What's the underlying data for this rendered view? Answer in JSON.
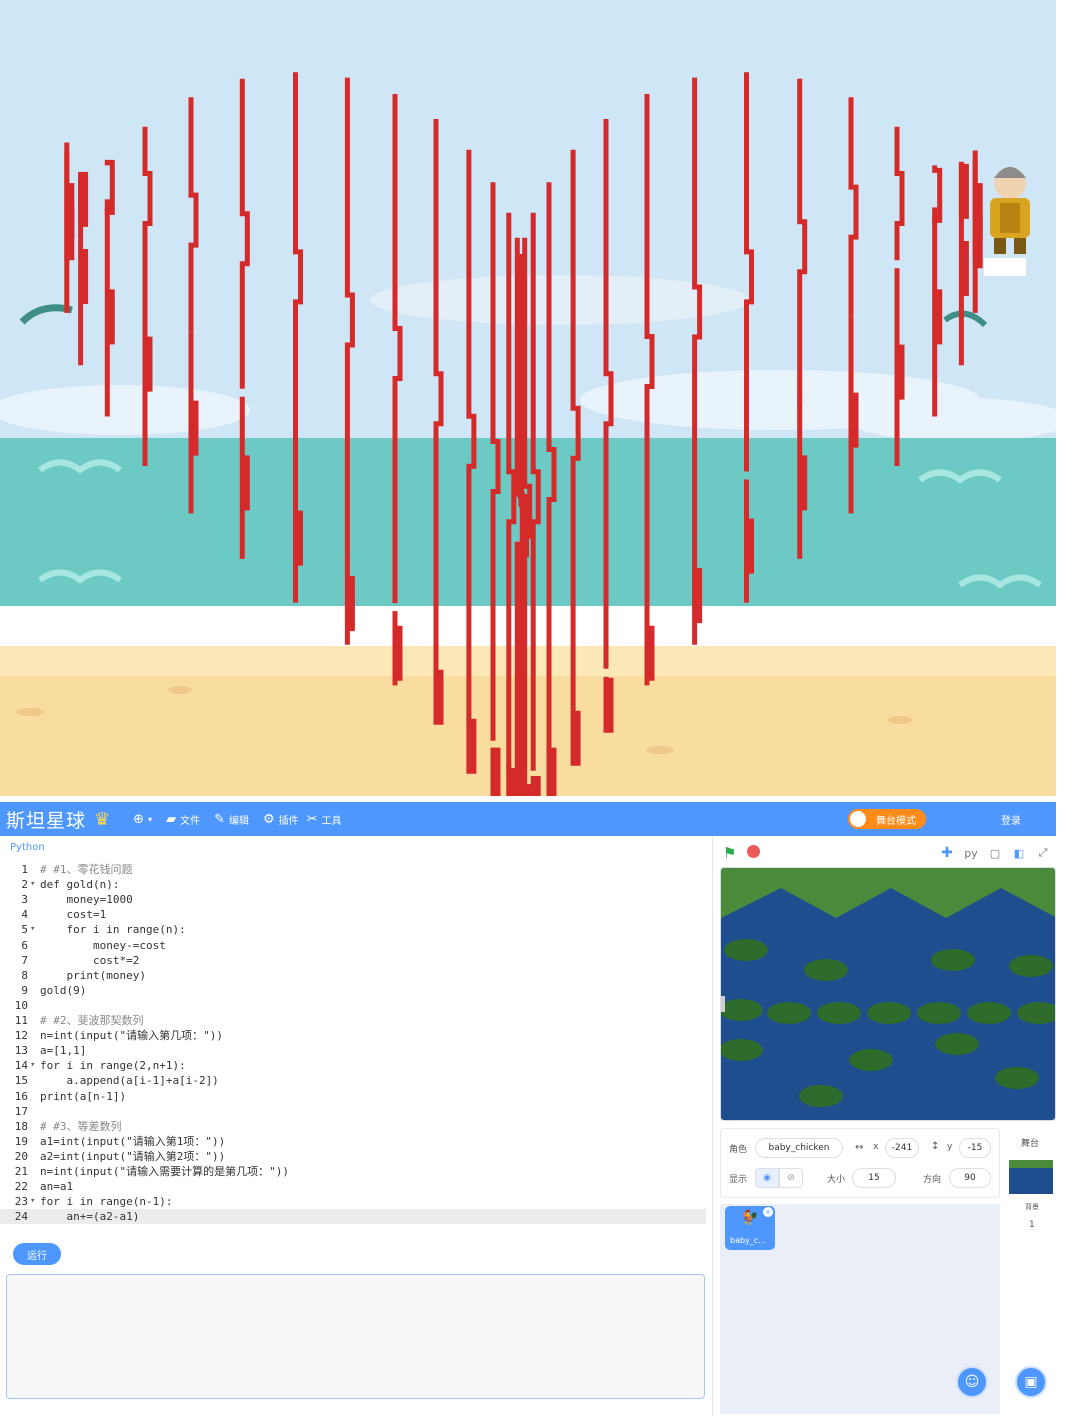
{
  "menubar": {
    "logo": "斯坦星球",
    "file": "文件",
    "edit": "编辑",
    "widgets": "插件",
    "tools": "工具",
    "stage_mode": "舞台模式",
    "login": "登录"
  },
  "editor": {
    "language": "Python",
    "lines": [
      {
        "n": "1",
        "fold": "",
        "code": "# #1、零花钱问题",
        "type": "cmt"
      },
      {
        "n": "2",
        "fold": "▾",
        "code": "def gold(n):",
        "type": "code"
      },
      {
        "n": "3",
        "fold": "",
        "code": "    money=1000",
        "type": "code"
      },
      {
        "n": "4",
        "fold": "",
        "code": "    cost=1",
        "type": "code"
      },
      {
        "n": "5",
        "fold": "▾",
        "code": "    for i in range(n):",
        "type": "code"
      },
      {
        "n": "6",
        "fold": "",
        "code": "        money-=cost",
        "type": "code"
      },
      {
        "n": "7",
        "fold": "",
        "code": "        cost*=2",
        "type": "code"
      },
      {
        "n": "8",
        "fold": "",
        "code": "    print(money)",
        "type": "code"
      },
      {
        "n": "9",
        "fold": "",
        "code": "gold(9)",
        "type": "code"
      },
      {
        "n": "10",
        "fold": "",
        "code": "",
        "type": "code"
      },
      {
        "n": "11",
        "fold": "",
        "code": "# #2、斐波那契数列",
        "type": "cmt"
      },
      {
        "n": "12",
        "fold": "",
        "code": "n=int(input(\"请输入第几项：\"))",
        "type": "code"
      },
      {
        "n": "13",
        "fold": "",
        "code": "a=[1,1]",
        "type": "code"
      },
      {
        "n": "14",
        "fold": "▾",
        "code": "for i in range(2,n+1):",
        "type": "code"
      },
      {
        "n": "15",
        "fold": "",
        "code": "    a.append(a[i-1]+a[i-2])",
        "type": "code"
      },
      {
        "n": "16",
        "fold": "",
        "code": "print(a[n-1])",
        "type": "code"
      },
      {
        "n": "17",
        "fold": "",
        "code": "",
        "type": "code"
      },
      {
        "n": "18",
        "fold": "",
        "code": "# #3、等差数列",
        "type": "cmt"
      },
      {
        "n": "19",
        "fold": "",
        "code": "a1=int(input(\"请输入第1项：\"))",
        "type": "code"
      },
      {
        "n": "20",
        "fold": "",
        "code": "a2=int(input(\"请输入第2项：\"))",
        "type": "code"
      },
      {
        "n": "21",
        "fold": "",
        "code": "n=int(input(\"请输入需要计算的是第几项：\"))",
        "type": "code"
      },
      {
        "n": "22",
        "fold": "",
        "code": "an=a1",
        "type": "code"
      },
      {
        "n": "23",
        "fold": "▾",
        "code": "for i in range(n-1):",
        "type": "code"
      },
      {
        "n": "24",
        "fold": "",
        "code": "    an+=(a2-a1)",
        "type": "code"
      }
    ],
    "run_label": "运行"
  },
  "stage_tools": {
    "python_icon": "py"
  },
  "sprite_info": {
    "sprite_label": "角色",
    "sprite_name": "baby_chicken",
    "x_label": "x",
    "x_value": "-241",
    "y_label": "y",
    "y_value": "-15",
    "show_label": "显示",
    "size_label": "大小",
    "size_value": "15",
    "direction_label": "方向",
    "direction_value": "90"
  },
  "sprite_list": {
    "thumb_label": "baby_c..."
  },
  "stage_column": {
    "title": "舞台",
    "backdrop_label": "背景",
    "backdrop_count": "1"
  },
  "colors": {
    "accent": "#4d97ff",
    "heart": "#d42a2a",
    "sky": "#cfe6f6",
    "sea": "#6cc9c4",
    "sand": "#f9dca0"
  }
}
